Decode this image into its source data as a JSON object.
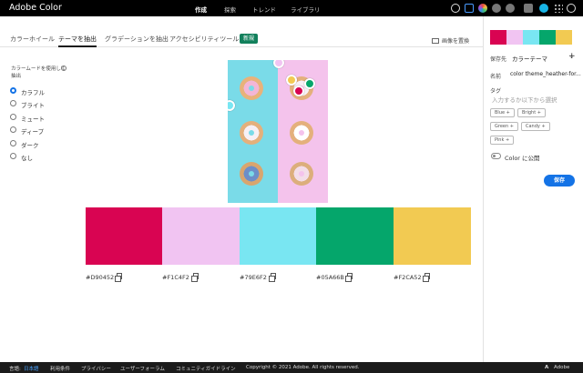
{
  "app": {
    "brand": "Adobe Color"
  },
  "topnav": [
    {
      "label": "作成",
      "active": true
    },
    {
      "label": "探索",
      "active": false
    },
    {
      "label": "トレンド",
      "active": false
    },
    {
      "label": "ライブラリ",
      "active": false
    }
  ],
  "tabs": [
    {
      "label": "カラーホイール",
      "active": false
    },
    {
      "label": "テーマを抽出",
      "active": true
    },
    {
      "label": "グラデーションを抽出",
      "active": false
    },
    {
      "label": "アクセシビリティツール",
      "active": false
    }
  ],
  "new_badge": "新規",
  "replace_image": "画像を置換",
  "mood": {
    "title": "カラームードを使用して抽出",
    "info_icon": "i",
    "options": [
      "カラフル",
      "ブライト",
      "ミュート",
      "ディープ",
      "ダーク",
      "なし"
    ],
    "selected": "カラフル"
  },
  "swatches": [
    {
      "hex": "#D90452",
      "color": "#D90452"
    },
    {
      "hex": "#F1C4F2",
      "color": "#F1C4F2"
    },
    {
      "hex": "#79E6F2",
      "color": "#79E6F2"
    },
    {
      "hex": "#05A66B",
      "color": "#05A66B"
    },
    {
      "hex": "#F2CA52",
      "color": "#F2CA52"
    }
  ],
  "panel": {
    "save_to_label": "保存先",
    "save_to_value": "カラーテーマ",
    "add_label": "+",
    "name_label": "名前",
    "name_value": "color theme_heather-for...",
    "tags_label": "タグ",
    "tags_placeholder": "入力するか以下から選択",
    "tags": [
      "Blue",
      "Bright",
      "Green",
      "Candy",
      "Pink"
    ],
    "publish_label": "Color に公開",
    "save_button": "保存"
  },
  "footer": {
    "language_label": "言語:",
    "language_value": "日本語",
    "links": [
      "利用条件",
      "プライバシー",
      "ユーザーフォーラム",
      "コミュニティガイドライン"
    ],
    "copyright": "Copyright © 2021 Adobe. All rights reserved.",
    "adobe": "Adobe"
  },
  "colors": {
    "accent": "#1473e6",
    "new_badge": "#12805c",
    "topbar": "#000000",
    "photo_left": "#7adbe8",
    "photo_right": "#f4c3ec"
  }
}
